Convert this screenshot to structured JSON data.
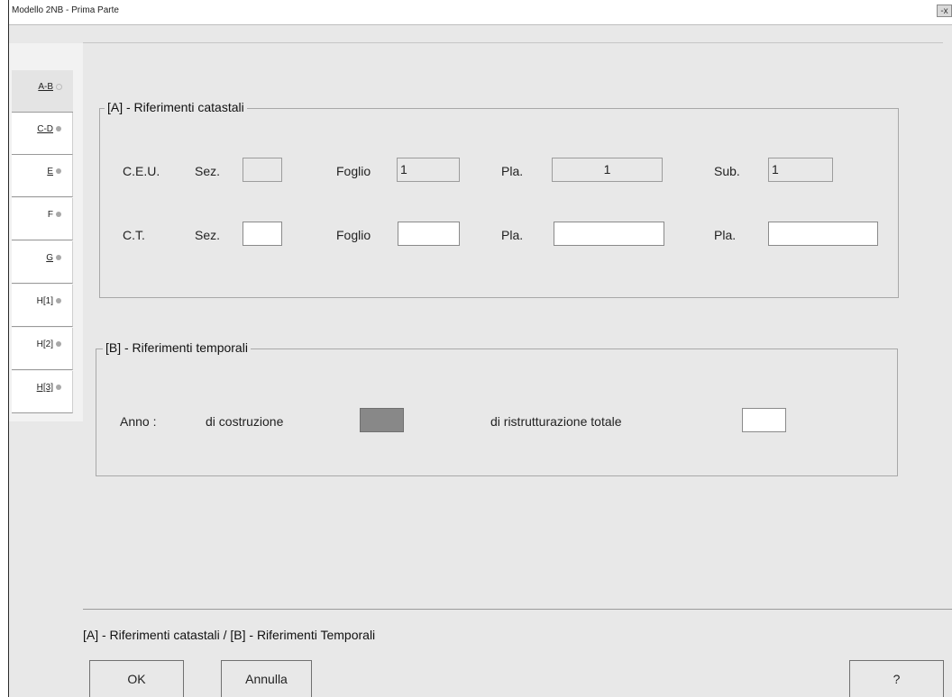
{
  "window": {
    "title": "Modello 2NB - Prima Parte",
    "close_glyph": "-x"
  },
  "tabs": [
    {
      "label": "A-B",
      "status": "light"
    },
    {
      "label": "C-D",
      "status": "gray"
    },
    {
      "label": "E",
      "status": "gray"
    },
    {
      "label": "F",
      "status": "gray"
    },
    {
      "label": "G",
      "status": "gray"
    },
    {
      "label": "H[1]",
      "status": "gray"
    },
    {
      "label": "H[2]",
      "status": "gray"
    },
    {
      "label": "H[3]",
      "status": "gray"
    }
  ],
  "section_a": {
    "title": "[A] - Riferimenti catastali",
    "ceu": {
      "row_label": "C.E.U.",
      "sez_label": "Sez.",
      "sez_value": "",
      "foglio_label": "Foglio",
      "foglio_value": "1",
      "pla_label": "Pla.",
      "pla_value": "1",
      "sub_label": "Sub.",
      "sub_value": "1"
    },
    "ct": {
      "row_label": "C.T.",
      "sez_label": "Sez.",
      "sez_value": "",
      "foglio_label": "Foglio",
      "foglio_value": "",
      "pla_label": "Pla.",
      "pla_value": "",
      "pla2_label": "Pla.",
      "pla2_value": ""
    }
  },
  "section_b": {
    "title": "[B] - Riferimenti temporali",
    "anno_label": "Anno :",
    "costruzione_label": "di costruzione",
    "costruzione_value": "",
    "ristrutturazione_label": "di ristrutturazione totale",
    "ristrutturazione_value": ""
  },
  "footer": {
    "description": "[A] - Riferimenti catastali / [B] - Riferimenti Temporali",
    "ok_label": "OK",
    "cancel_label": "Annulla",
    "help_label": "?"
  },
  "colors": {
    "background": "#e8e8e8",
    "readonly_field": "#e8e8e8",
    "editable_field": "#ffffff",
    "disabled_field": "#888888"
  }
}
